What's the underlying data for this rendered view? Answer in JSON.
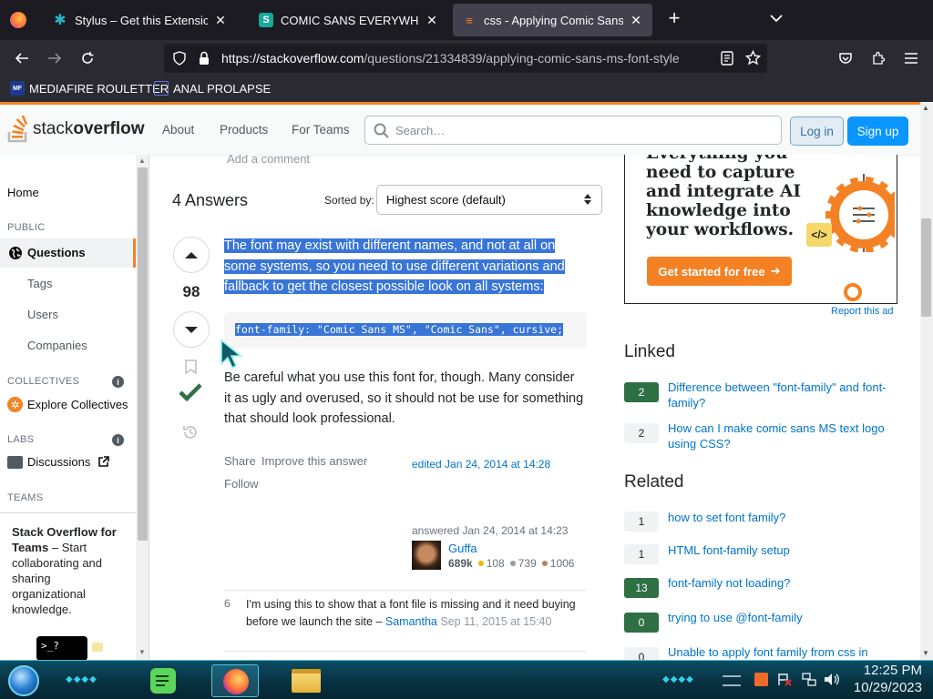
{
  "browser": {
    "tabs": [
      {
        "title": "Stylus – Get this Extension for",
        "active": false
      },
      {
        "title": "COMIC SANS EVERYWHERE – G",
        "active": false
      },
      {
        "title": "css - Applying Comic Sans Ms",
        "active": true
      }
    ],
    "url_host": "https://stackoverflow.com",
    "url_path": "/questions/21334839/applying-comic-sans-ms-font-style",
    "bookmarks": [
      "MEDIAFIRE ROULETTER",
      "ANAL PROLAPSE"
    ]
  },
  "so_header": {
    "logo_light": "stack",
    "logo_bold": "overflow",
    "nav": [
      "About",
      "Products",
      "For Teams"
    ],
    "search_placeholder": "Search…",
    "login": "Log in",
    "signup": "Sign up"
  },
  "leftnav": {
    "home": "Home",
    "public_head": "PUBLIC",
    "questions": "Questions",
    "tags": "Tags",
    "users": "Users",
    "companies": "Companies",
    "collectives_head": "COLLECTIVES",
    "explore_collectives": "Explore Collectives",
    "labs_head": "LABS",
    "discussions": "Discussions",
    "teams_head": "TEAMS",
    "teams_promo_title": "Stack Overflow for Teams",
    "teams_promo_text": " – Start collaborating and sharing organizational knowledge."
  },
  "main": {
    "add_comment": "Add a comment",
    "answers_count": "4 Answers",
    "sorted_by_label": "Sorted by:",
    "sort_value": "Highest score (default)",
    "answer": {
      "score": "98",
      "para1": "The font may exist with different names, and not at all on some systems, so you need to use different variations and fallback to get the closest possible look on all systems:",
      "code": "font-family: \"Comic Sans MS\", \"Comic Sans\", cursive;",
      "para2": "Be careful what you use this font for, though. Many consider it as ugly and overused, so it should not be use for something that should look professional.",
      "share": "Share",
      "improve": "Improve this answer",
      "follow": "Follow",
      "edited": "edited Jan 24, 2014 at 14:28",
      "answered": "answered Jan 24, 2014 at 14:23",
      "user": "Guffa",
      "rep": "689k",
      "gold": "108",
      "silver": "739",
      "bronze": "1006"
    },
    "comment": {
      "score": "6",
      "text": "I'm using this to show that a font file is missing and it need buying before we launch the site –",
      "user": "Samantha",
      "time": "Sep 11, 2015 at 15:40"
    }
  },
  "sidebar": {
    "ad_lines": [
      "Everything you",
      "need to capture",
      "and integrate AI",
      "knowledge into",
      "your workflows."
    ],
    "ad_button": "Get started for free",
    "report_ad": "Report this ad",
    "linked_head": "Linked",
    "linked": [
      {
        "score": "2",
        "title": "Difference between \"font-family\" and font-family?",
        "accepted": true
      },
      {
        "score": "2",
        "title": "How can I make comic sans MS text logo using CSS?",
        "accepted": false
      }
    ],
    "related_head": "Related",
    "related": [
      {
        "score": "1",
        "title": "how to set font family?",
        "accepted": false
      },
      {
        "score": "1",
        "title": "HTML font-family setup",
        "accepted": false
      },
      {
        "score": "13",
        "title": "font-family not loading?",
        "accepted": true
      },
      {
        "score": "0",
        "title": "trying to use @font-family",
        "accepted": true
      },
      {
        "score": "0",
        "title": "Unable to apply font family from css in",
        "accepted": false
      }
    ]
  },
  "taskbar": {
    "terminal_label": ">_?",
    "time": "12:25 PM",
    "date": "10/29/2023"
  }
}
